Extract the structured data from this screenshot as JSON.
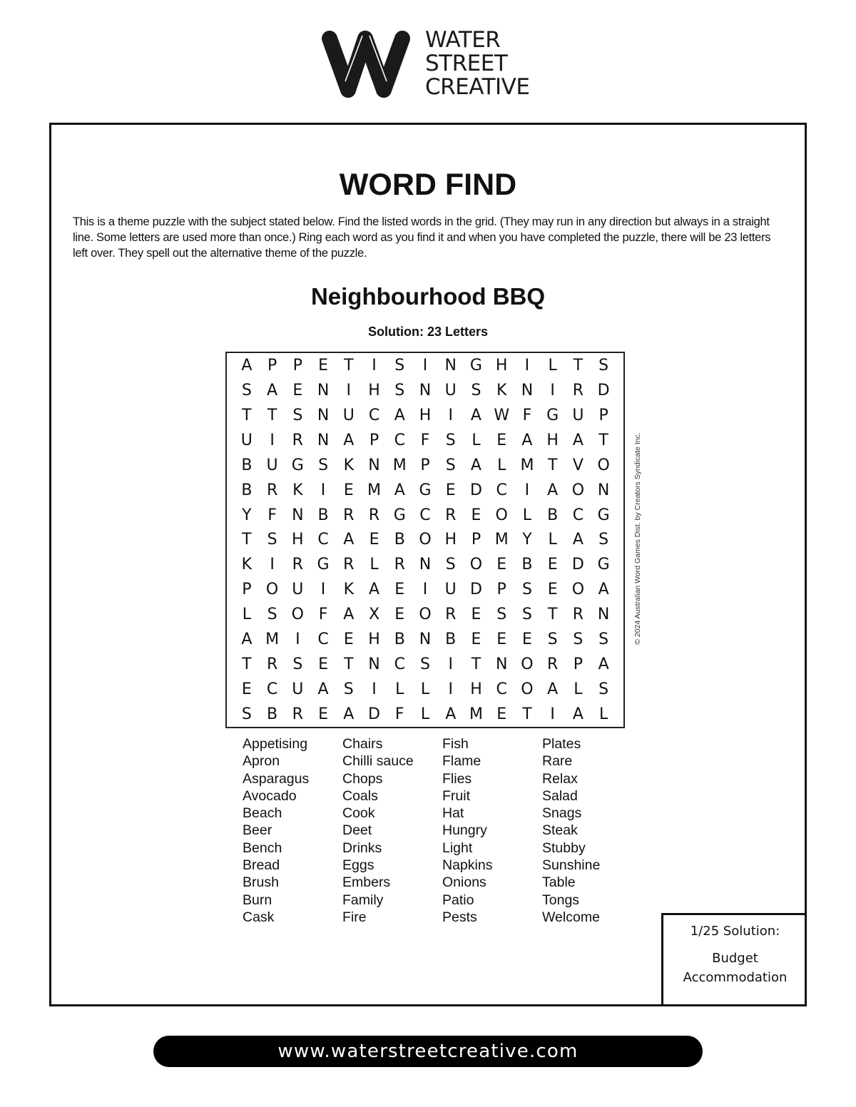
{
  "brand": {
    "logo_icon": "w-logo-icon",
    "lines": [
      "WATER",
      "STREET",
      "CREATIVE"
    ],
    "url": "www.waterstreetcreative.com"
  },
  "puzzle": {
    "title": "WORD FIND",
    "instructions": "This is a theme puzzle with the subject stated below. Find the listed words in the grid. (They may run in any direction but always in a straight line. Some letters are used more than once.) Ring each word as you find it and when you have completed the puzzle, there will be 23 letters left over. They spell out the alternative theme of the puzzle.",
    "theme": "Neighbourhood BBQ",
    "solution_count": "Solution: 23 Letters",
    "copyright": "© 2024 Australian Word Games Dist. by Creators Syndicate Inc.",
    "grid": [
      "APPETISINGHILTS",
      "SAENIHSNUSKNIRD",
      "TTSNUCAHIAWFGUP",
      "UIRNAPCFSLEAHAT",
      "BUGSKNMPSALMTVO",
      "BRKIEMAGEDCIAON",
      "YFNBRRGCREOLBCG",
      "TSHCAEBOHPMYLAS",
      "KIRGRLRNSOEBEDG",
      "POUIKAEIUDPSEOA",
      "LSOFAXEORESSTRN",
      "AMICEHBNBEEESSS",
      "TRSETNCSITNORPA",
      "ECUASILLIHCOALS",
      "SBREADFLAMETIAL"
    ],
    "word_columns": [
      [
        "Appetising",
        "Apron",
        "Asparagus",
        "Avocado",
        "Beach",
        "Beer",
        "Bench",
        "Bread",
        "Brush",
        "Burn",
        "Cask"
      ],
      [
        "Chairs",
        "Chilli sauce",
        "Chops",
        "Coals",
        "Cook",
        "Deet",
        "Drinks",
        "Eggs",
        "Embers",
        "Family",
        "Fire"
      ],
      [
        "Fish",
        "Flame",
        "Flies",
        "Fruit",
        "Hat",
        "Hungry",
        "Light",
        "Napkins",
        "Onions",
        "Patio",
        "Pests"
      ],
      [
        "Plates",
        "Rare",
        "Relax",
        "Salad",
        "Snags",
        "Steak",
        "Stubby",
        "Sunshine",
        "Table",
        "Tongs",
        "Welcome"
      ]
    ]
  },
  "previous_solution": {
    "label": "1/25 Solution:",
    "answer_line1": "Budget",
    "answer_line2": "Accommodation"
  }
}
